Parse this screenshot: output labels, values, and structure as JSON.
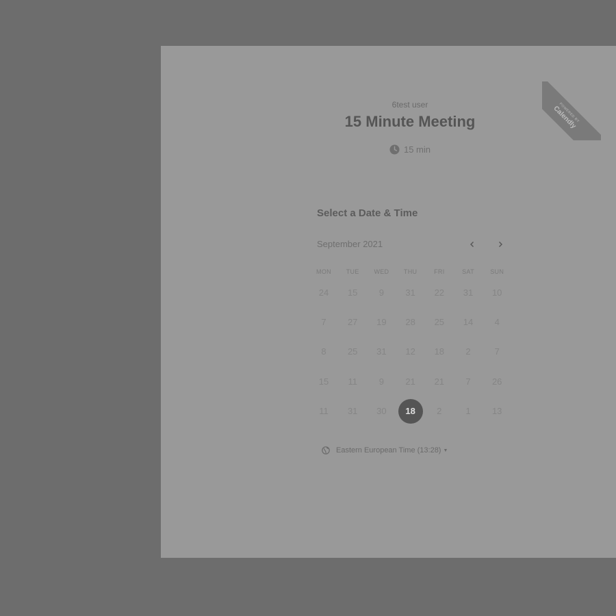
{
  "event": {
    "host": "6test user",
    "title": "15 Minute Meeting",
    "duration": "15 min"
  },
  "ribbon": {
    "small": "POWERED BY",
    "brand": "Calendly"
  },
  "calendar": {
    "section_title": "Select a Date & Time",
    "month": "September 2021",
    "prev_icon": "chevron-left-icon",
    "next_icon": "chevron-right-icon",
    "weekdays": [
      "MON",
      "TUE",
      "WED",
      "THU",
      "FRI",
      "SAT",
      "SUN"
    ],
    "weeks": [
      [
        "24",
        "15",
        "9",
        "31",
        "22",
        "31",
        "10"
      ],
      [
        "7",
        "27",
        "19",
        "28",
        "25",
        "14",
        "4"
      ],
      [
        "8",
        "25",
        "31",
        "12",
        "18",
        "2",
        "7"
      ],
      [
        "15",
        "11",
        "9",
        "21",
        "21",
        "7",
        "26"
      ],
      [
        "11",
        "31",
        "30",
        "18",
        "2",
        "1",
        "13"
      ]
    ],
    "selected": "18"
  },
  "timezone": {
    "label": "Eastern European Time (13:28)",
    "icon": "globe-icon"
  },
  "colors": {
    "backdrop": "#6d6d6d",
    "card": "#999999",
    "selected_day": "#555555"
  }
}
